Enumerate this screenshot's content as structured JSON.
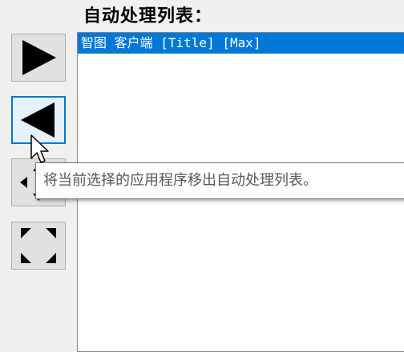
{
  "header": {
    "title": "自动处理列表："
  },
  "buttons": [
    {
      "name": "add-to-list-button",
      "icon": "play-right-icon"
    },
    {
      "name": "remove-from-list-button",
      "icon": "play-left-icon",
      "hovered": true
    },
    {
      "name": "resize-button",
      "icon": "resize-arrows-icon"
    },
    {
      "name": "maximize-button",
      "icon": "expand-arrows-icon"
    }
  ],
  "list": {
    "items": [
      {
        "label": "智图 客户端 [Title] [Max]",
        "selected": true
      }
    ]
  },
  "tooltip": {
    "text": "将当前选择的应用程序移出自动处理列表。"
  },
  "colors": {
    "selection": "#0078d7",
    "hover_border": "#0078d7"
  }
}
